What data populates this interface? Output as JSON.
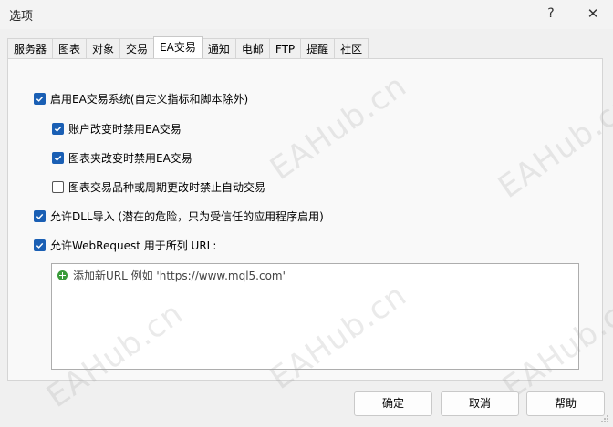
{
  "window": {
    "title": "选项",
    "help_glyph": "?",
    "close_glyph": "✕"
  },
  "tabs": [
    {
      "label": "服务器"
    },
    {
      "label": "图表"
    },
    {
      "label": "对象"
    },
    {
      "label": "交易"
    },
    {
      "label": "EA交易",
      "active": true
    },
    {
      "label": "通知"
    },
    {
      "label": "电邮"
    },
    {
      "label": "FTP"
    },
    {
      "label": "提醒"
    },
    {
      "label": "社区"
    }
  ],
  "options": {
    "enable_ea": {
      "label": "启用EA交易系统(自定义指标和脚本除外)",
      "checked": true
    },
    "disable_on_account_change": {
      "label": "账户改变时禁用EA交易",
      "checked": true
    },
    "disable_on_profile_change": {
      "label": "图表夹改变时禁用EA交易",
      "checked": true
    },
    "disable_on_symbol_change": {
      "label": "图表交易品种或周期更改时禁止自动交易",
      "checked": false
    },
    "allow_dll": {
      "label": "允许DLL导入 (潜在的危险，只为受信任的应用程序启用)",
      "checked": true
    },
    "allow_webrequest": {
      "label": "允许WebRequest 用于所列 URL:",
      "checked": true
    }
  },
  "url_list": {
    "add_item": "添加新URL 例如 'https://www.mql5.com'"
  },
  "buttons": {
    "ok": "确定",
    "cancel": "取消",
    "help": "帮助"
  },
  "watermark": "EAHub.cn",
  "colors": {
    "checkbox_accent": "#1a5fb4",
    "add_icon": "#3a9b3a"
  }
}
